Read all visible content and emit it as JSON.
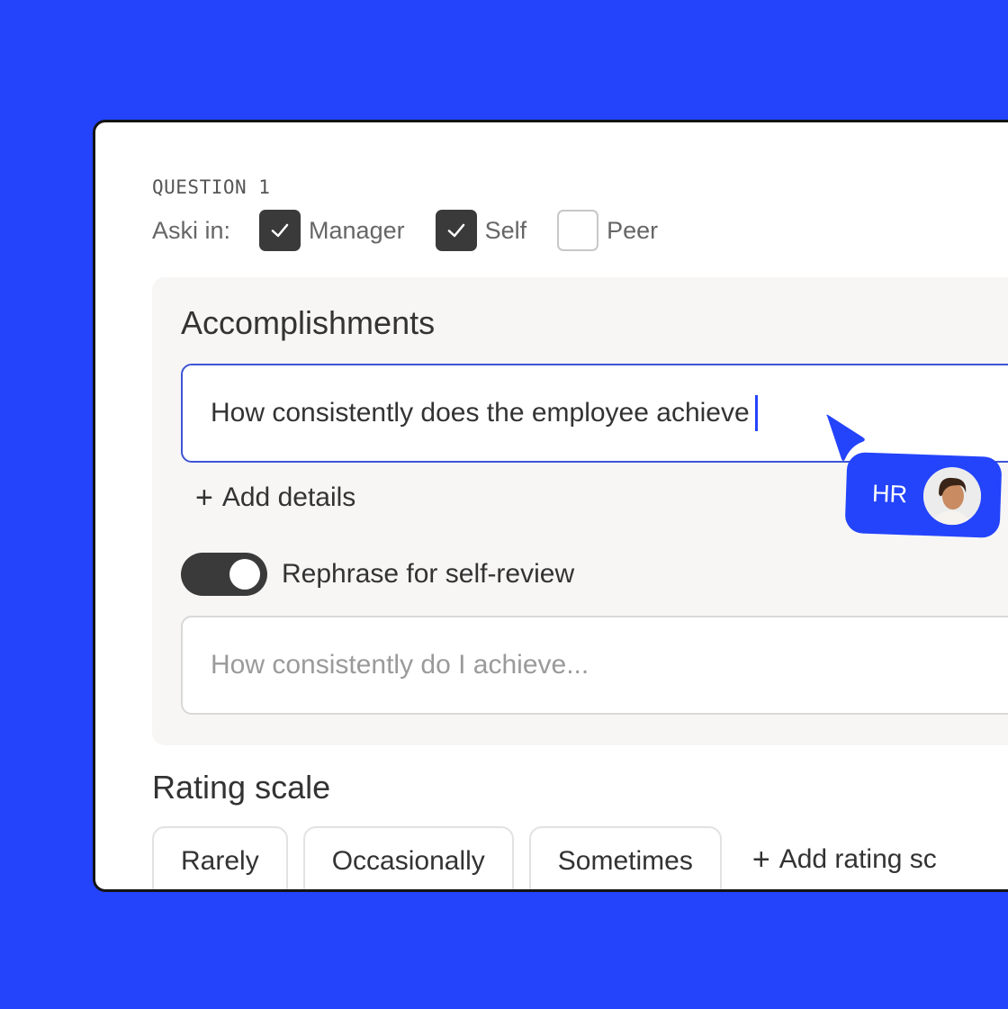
{
  "question": {
    "label": "QUESTION 1",
    "ask_in_label": "Aski in:",
    "audiences": [
      {
        "label": "Manager",
        "checked": true
      },
      {
        "label": "Self",
        "checked": true
      },
      {
        "label": "Peer",
        "checked": false
      }
    ]
  },
  "section": {
    "title": "Accomplishments",
    "question_text": "How consistently does the employee achieve",
    "add_details_label": "Add details",
    "toggle_label": "Rephrase for self-review",
    "toggle_on": true,
    "self_review_placeholder": "How consistently do I achieve..."
  },
  "rating_scale": {
    "title": "Rating scale",
    "options": [
      "Rarely",
      "Occasionally",
      "Sometimes"
    ],
    "add_label": "Add rating sc"
  },
  "collaborator": {
    "label": "HR",
    "color": "#2444fb"
  },
  "colors": {
    "background": "#2444fb",
    "accent": "#2444fb",
    "dark": "#3a3a3a"
  }
}
